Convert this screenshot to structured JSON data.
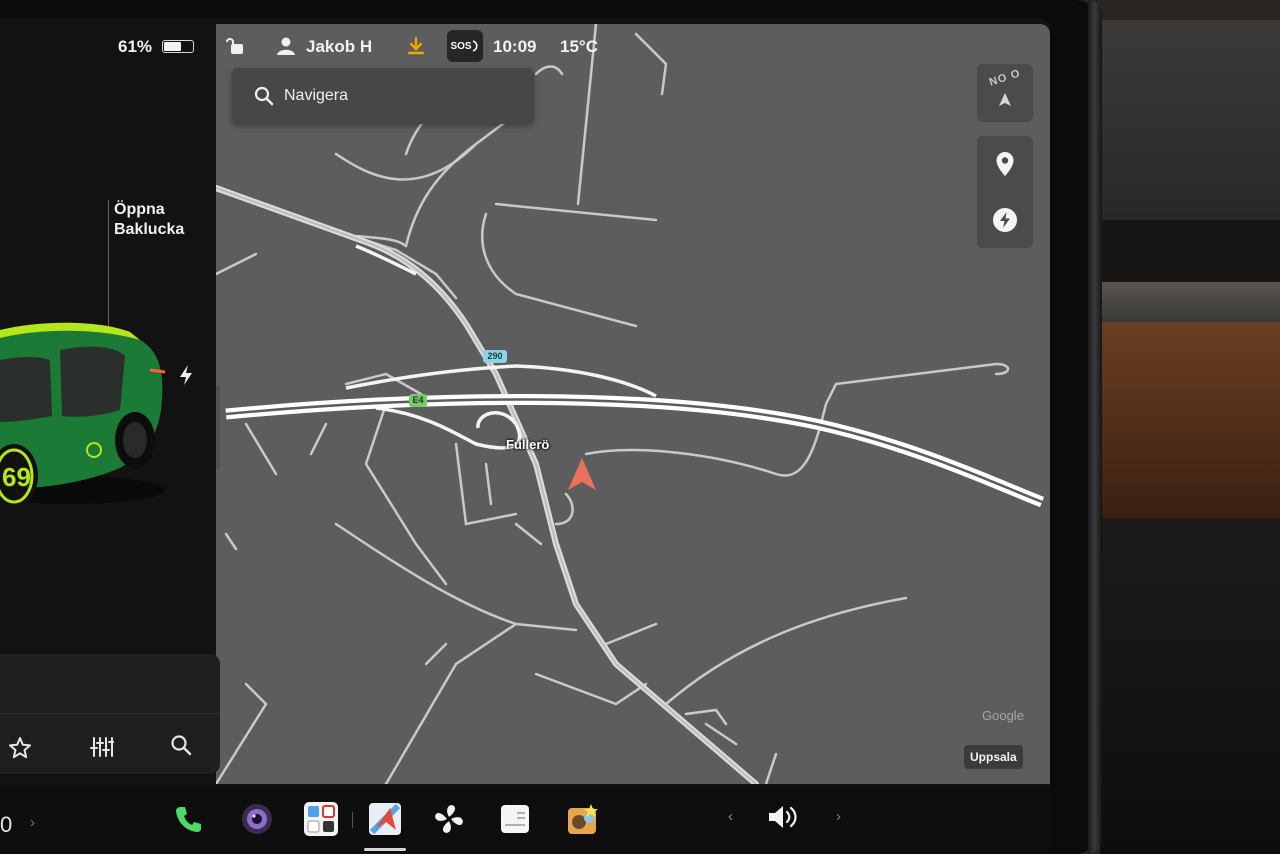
{
  "status": {
    "battery_percent_text": "61%",
    "battery_level": 0.61,
    "profile_name": "Jakob H",
    "sos_label": "SOS",
    "clock": "10:09",
    "temperature": "15°C"
  },
  "car_panel": {
    "trunk_line1": "Öppna",
    "trunk_line2": "Baklucka",
    "badge_number": "69"
  },
  "map": {
    "search_placeholder": "Navigera",
    "compass_label": "NO O",
    "place_label": "Fullerö",
    "route_290": "290",
    "route_e4": "E4",
    "attribution": "Google",
    "region": "Uppsala"
  },
  "taskbar": {
    "odometer_partial": "0",
    "left_chevron": "›",
    "prev_chevron": "‹",
    "next_chevron": "›"
  },
  "colors": {
    "map_bg": "#5d5d5f",
    "road": "#ffffff",
    "nav_arrow": "#e8725a",
    "download": "#f0a400",
    "car_green": "#1f8a3a",
    "car_accent": "#b5e61d"
  },
  "icons": [
    "lock-icon",
    "profile-icon",
    "download-icon",
    "sos-icon",
    "search-icon",
    "compass-icon",
    "pin-icon",
    "charger-icon",
    "star-icon",
    "equalizer-icon",
    "phone-icon",
    "camera-icon",
    "apps-icon",
    "nav-app-icon",
    "fan-icon",
    "notes-icon",
    "toybox-icon",
    "volume-icon",
    "lightning-icon"
  ]
}
